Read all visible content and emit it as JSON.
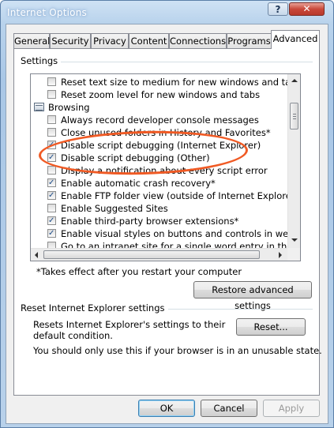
{
  "window": {
    "title": "Internet Options",
    "help_label": "?",
    "close_label": "✕"
  },
  "tabs": [
    {
      "label": "General",
      "active": false
    },
    {
      "label": "Security",
      "active": false
    },
    {
      "label": "Privacy",
      "active": false
    },
    {
      "label": "Content",
      "active": false
    },
    {
      "label": "Connections",
      "active": false
    },
    {
      "label": "Programs",
      "active": false
    },
    {
      "label": "Advanced",
      "active": true
    }
  ],
  "settings": {
    "group_label": "Settings",
    "items": [
      {
        "type": "checkbox",
        "checked": false,
        "label": "Reset text size to medium for new windows and tabs"
      },
      {
        "type": "checkbox",
        "checked": false,
        "label": "Reset zoom level for new windows and tabs"
      },
      {
        "type": "category",
        "label": "Browsing"
      },
      {
        "type": "checkbox",
        "checked": false,
        "label": "Always record developer console messages"
      },
      {
        "type": "checkbox",
        "checked": false,
        "label": "Close unused folders in History and Favorites*"
      },
      {
        "type": "checkbox",
        "checked": true,
        "label": "Disable script debugging (Internet Explorer)"
      },
      {
        "type": "checkbox",
        "checked": true,
        "label": "Disable script debugging (Other)"
      },
      {
        "type": "checkbox",
        "checked": false,
        "label": "Display a notification about every script error"
      },
      {
        "type": "checkbox",
        "checked": true,
        "label": "Enable automatic crash recovery*"
      },
      {
        "type": "checkbox",
        "checked": true,
        "label": "Enable FTP folder view (outside of Internet Explorer)"
      },
      {
        "type": "checkbox",
        "checked": false,
        "label": "Enable Suggested Sites"
      },
      {
        "type": "checkbox",
        "checked": true,
        "label": "Enable third-party browser extensions*"
      },
      {
        "type": "checkbox",
        "checked": true,
        "label": "Enable visual styles on buttons and controls in webpages"
      },
      {
        "type": "checkbox",
        "checked": false,
        "label": "Go to an intranet site for a single word entry in the Address"
      }
    ],
    "footnote": "*Takes effect after you restart your computer",
    "restore_button": "Restore advanced settings"
  },
  "reset": {
    "group_label": "Reset Internet Explorer settings",
    "description": "Resets Internet Explorer's settings to their default condition.",
    "warning": "You should only use this if your browser is in an unusable state.",
    "button": "Reset..."
  },
  "footer": {
    "ok": "OK",
    "cancel": "Cancel",
    "apply": "Apply"
  }
}
